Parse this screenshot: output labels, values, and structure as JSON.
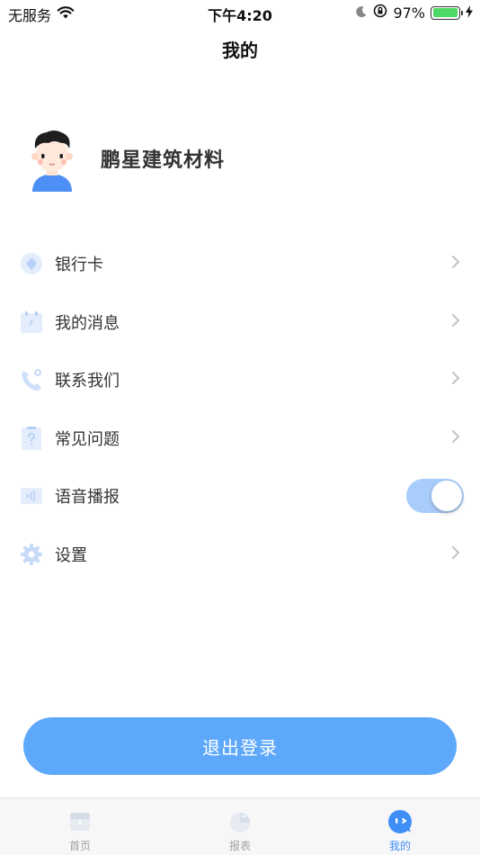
{
  "status_bar": {
    "carrier": "无服务",
    "time": "下午4:20",
    "battery_percent": "97%",
    "battery_level": 0.97
  },
  "nav": {
    "title": "我的"
  },
  "profile": {
    "name": "鹏星建筑材料"
  },
  "menu": [
    {
      "label": "银行卡",
      "icon": "bank-card-icon",
      "accessory": "chevron"
    },
    {
      "label": "我的消息",
      "icon": "message-icon",
      "accessory": "chevron"
    },
    {
      "label": "联系我们",
      "icon": "phone-icon",
      "accessory": "chevron"
    },
    {
      "label": "常见问题",
      "icon": "question-icon",
      "accessory": "chevron"
    },
    {
      "label": "语音播报",
      "icon": "voice-icon",
      "accessory": "toggle",
      "toggle_on": true
    },
    {
      "label": "设置",
      "icon": "gear-icon",
      "accessory": "chevron"
    }
  ],
  "logout_label": "退出登录",
  "tabs": [
    {
      "label": "首页",
      "icon": "home-icon",
      "active": false
    },
    {
      "label": "报表",
      "icon": "report-icon",
      "active": false
    },
    {
      "label": "我的",
      "icon": "profile-icon",
      "active": true
    }
  ],
  "colors": {
    "accent": "#3e8ef7",
    "logout_button": "#5ea8fb",
    "toggle_track": "#a9cdfb",
    "battery": "#4cd964"
  }
}
